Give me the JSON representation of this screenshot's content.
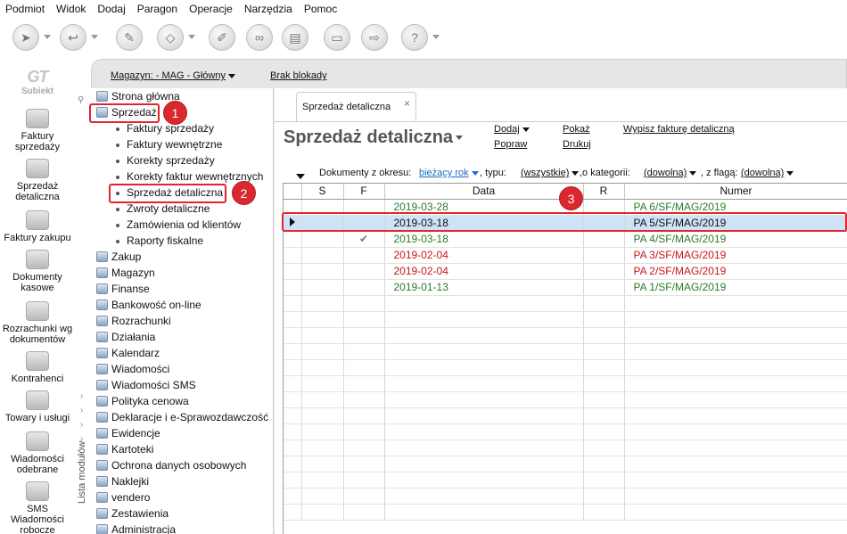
{
  "menu": [
    "Podmiot",
    "Widok",
    "Dodaj",
    "Paragon",
    "Operacje",
    "Narzędzia",
    "Pomoc"
  ],
  "logo": {
    "mark": "GT",
    "text": "Subiekt"
  },
  "leftbar": [
    {
      "label": "Faktury sprzedaży",
      "icon": "invoices-icon"
    },
    {
      "label": "Sprzedaż detaliczna",
      "icon": "retail-icon"
    },
    {
      "label": "Faktury zakupu",
      "icon": "purchase-invoices-icon"
    },
    {
      "label": "Dokumenty kasowe",
      "icon": "cash-documents-icon"
    },
    {
      "label": "Rozrachunki wg dokumentów",
      "icon": "settlements-icon"
    },
    {
      "label": "Kontrahenci",
      "icon": "contractors-icon"
    },
    {
      "label": "Towary i usługi",
      "icon": "goods-icon"
    },
    {
      "label": "Wiadomości odebrane",
      "icon": "messages-icon"
    },
    {
      "label": "SMS Wiadomości robocze",
      "icon": "sms-icon"
    }
  ],
  "topinfo": {
    "warehouse": "Magazyn: - MAG - Główny",
    "lock": "Brak blokady"
  },
  "sidebar_label": "Lista modułów",
  "tree": {
    "top": [
      "Strona główna",
      "Sprzedaż"
    ],
    "sub": [
      "Faktury sprzedaży",
      "Faktury wewnętrzne",
      "Korekty sprzedaży",
      "Korekty faktur wewnętrznych",
      "Sprzedaż detaliczna",
      "Zwroty detaliczne",
      "Zamówienia od klientów",
      "Raporty fiskalne"
    ],
    "rest": [
      "Zakup",
      "Magazyn",
      "Finanse",
      "Bankowość on-line",
      "Rozrachunki",
      "Działania",
      "Kalendarz",
      "Wiadomości",
      "Wiadomości SMS",
      "Polityka cenowa",
      "Deklaracje i e-Sprawozdawczość",
      "Ewidencje",
      "Kartoteki",
      "Ochrona danych osobowych",
      "Naklejki",
      "vendero",
      "Zestawienia",
      "Administracja"
    ]
  },
  "badges": [
    "1",
    "2",
    "3"
  ],
  "tab": {
    "label": "Sprzedaż detaliczna",
    "close": "×"
  },
  "heading": "Sprzedaż detaliczna",
  "actions": {
    "add": "Dodaj",
    "correct": "Popraw",
    "show": "Pokaż",
    "print": "Drukuj",
    "issue": "Wypisz fakturę detaliczną"
  },
  "filters": {
    "period_label": "Dokumenty z okresu:",
    "period_value": "bieżący rok",
    "type_label": ", typu:",
    "type_value": "(wszystkie)",
    "category_label": ",o kategorii:",
    "category_value": "(dowolna)",
    "flag_label": ", z flagą:",
    "flag_value": "(dowolna)"
  },
  "columns": [
    "S",
    "F",
    "Data",
    "R",
    "Numer"
  ],
  "rows": [
    {
      "s": "",
      "f": "",
      "date": "2019-03-28",
      "r": "",
      "number": "PA 6/SF/MAG/2019",
      "color": "green",
      "selected": false
    },
    {
      "s": "",
      "f": "",
      "date": "2019-03-18",
      "r": "",
      "number": "PA 5/SF/MAG/2019",
      "color": "green",
      "selected": true
    },
    {
      "s": "",
      "f": "✔",
      "date": "2019-03-18",
      "r": "",
      "number": "PA 4/SF/MAG/2019",
      "color": "green",
      "selected": false
    },
    {
      "s": "",
      "f": "",
      "date": "2019-02-04",
      "r": "",
      "number": "PA 3/SF/MAG/2019",
      "color": "red",
      "selected": false
    },
    {
      "s": "",
      "f": "",
      "date": "2019-02-04",
      "r": "",
      "number": "PA 2/SF/MAG/2019",
      "color": "red",
      "selected": false
    },
    {
      "s": "",
      "f": "",
      "date": "2019-01-13",
      "r": "",
      "number": "PA 1/SF/MAG/2019",
      "color": "green",
      "selected": false
    }
  ],
  "colors": {
    "green": "#2d7a2d",
    "red": "#c9161d",
    "highlight": "#e0252b",
    "selection": "#cfe3f7"
  }
}
